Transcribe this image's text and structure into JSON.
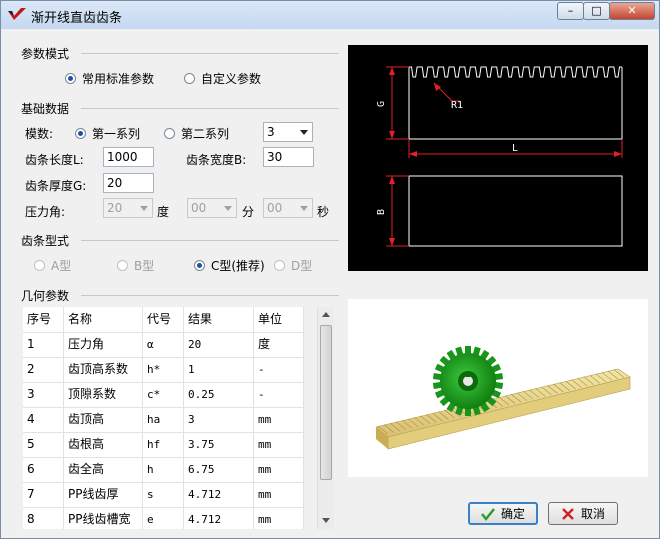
{
  "window": {
    "title": "渐开线直齿齿条",
    "btn_min": "–",
    "btn_max": "□",
    "btn_close": "✕"
  },
  "param_mode": {
    "label": "参数模式",
    "opt_standard": "常用标准参数",
    "opt_custom": "自定义参数",
    "selected": "standard"
  },
  "basic_data": {
    "label": "基础数据",
    "module_label": "模数:",
    "series1": "第一系列",
    "series2": "第二系列",
    "module_value": "3",
    "length_label": "齿条长度L:",
    "length_value": "1000",
    "width_label": "齿条宽度B:",
    "width_value": "30",
    "thickness_label": "齿条厚度G:",
    "thickness_value": "20",
    "pressure_label": "压力角:",
    "deg_value": "20",
    "deg_unit": "度",
    "min_value": "00",
    "min_unit": "分",
    "sec_value": "00",
    "sec_unit": "秒"
  },
  "rack_type": {
    "label": "齿条型式",
    "a": "A型",
    "b": "B型",
    "c": "C型(推荐)",
    "d": "D型"
  },
  "geometry": {
    "label": "几何参数",
    "headers": [
      "序号",
      "名称",
      "代号",
      "结果",
      "单位"
    ],
    "rows": [
      [
        "1",
        "压力角",
        "α",
        "20",
        "度"
      ],
      [
        "2",
        "齿顶高系数",
        "h*",
        "1",
        "-"
      ],
      [
        "3",
        "顶隙系数",
        "c*",
        "0.25",
        "-"
      ],
      [
        "4",
        "齿顶高",
        "ha",
        "3",
        "mm"
      ],
      [
        "5",
        "齿根高",
        "hf",
        "3.75",
        "mm"
      ],
      [
        "6",
        "齿全高",
        "h",
        "6.75",
        "mm"
      ],
      [
        "7",
        "PP线齿厚",
        "s",
        "4.712",
        "mm"
      ],
      [
        "8",
        "PP线齿槽宽",
        "e",
        "4.712",
        "mm"
      ]
    ]
  },
  "drawing": {
    "label_g": "G",
    "label_r1": "R1",
    "label_l": "L",
    "label_b": "B"
  },
  "buttons": {
    "ok": "确定",
    "cancel": "取消"
  },
  "colors": {
    "accent": "#1f4fa3",
    "drawing_line": "#ffffff",
    "dimension": "#e0202a",
    "gear_green": "#1aa51a",
    "rack_tan": "#e6d28c"
  },
  "icons": {
    "ok": "check-icon",
    "cancel": "x-icon"
  }
}
